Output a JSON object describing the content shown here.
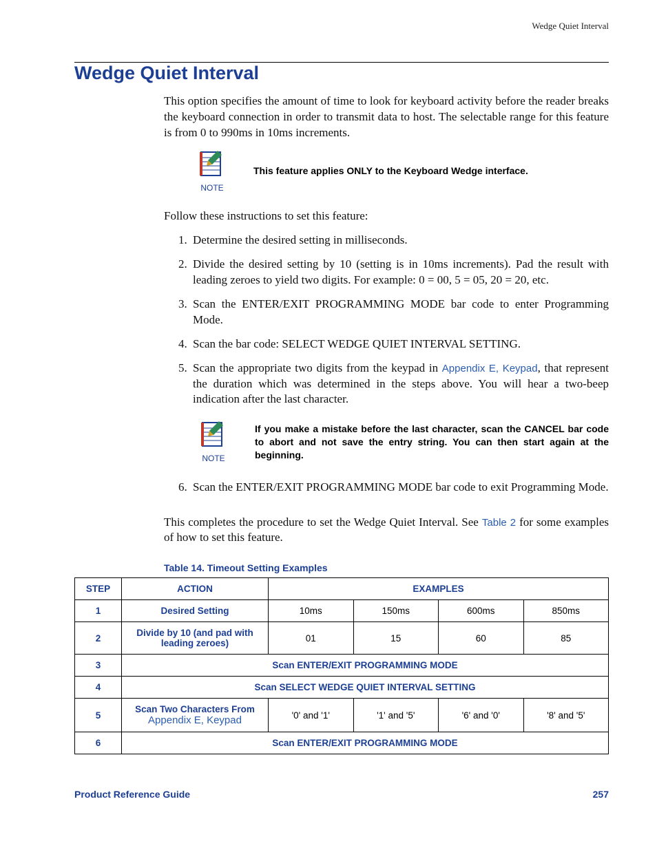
{
  "running_head": "Wedge Quiet Interval",
  "title": "Wedge Quiet Interval",
  "intro": "This option specifies the amount of time to look for keyboard activity before the reader breaks the keyboard connection in order to transmit data to host. The selectable range for this feature is from 0 to 990ms in 10ms increments.",
  "note1_label": "NOTE",
  "note1_text": "This feature applies ONLY to the Keyboard Wedge interface.",
  "follow": "Follow these instructions to set this feature:",
  "steps": {
    "s1": "Determine the desired setting in milliseconds.",
    "s2": "Divide the desired setting by 10 (setting is in 10ms increments).  Pad the result with leading zeroes to yield two digits. For example: 0 = 00, 5 = 05, 20 = 20, etc.",
    "s3": "Scan the ENTER/EXIT PROGRAMMING MODE bar code to enter Programming Mode.",
    "s4": "Scan the bar code: SELECT WEDGE QUIET INTERVAL SETTING.",
    "s5_pre": "Scan the appropriate two digits from the keypad in ",
    "s5_link": "Appendix E, Keypad",
    "s5_post": ", that represent the duration which was determined in the steps above. You will hear a two-beep indication after the last character.",
    "s6": "Scan the ENTER/EXIT PROGRAMMING MODE bar code to exit Programming Mode."
  },
  "note2_label": "NOTE",
  "note2_text": "If you make a mistake before the last character, scan the CANCEL bar code to abort and not save the entry string. You can then start again at the beginning.",
  "closing_pre": "This completes the procedure to set the Wedge Quiet Interval. See ",
  "closing_link": "Table 2",
  "closing_post": " for some examples of how to set this feature.",
  "table_caption": "Table 14. Timeout Setting Examples",
  "table": {
    "head": {
      "step": "STEP",
      "action": "ACTION",
      "examples": "EXAMPLES"
    },
    "r1": {
      "step": "1",
      "action": "Desired Setting",
      "c1": "10ms",
      "c2": "150ms",
      "c3": "600ms",
      "c4": "850ms"
    },
    "r2": {
      "step": "2",
      "action": "Divide by 10 (and pad with leading zeroes)",
      "c1": "01",
      "c2": "15",
      "c3": "60",
      "c4": "85"
    },
    "r3": {
      "step": "3",
      "action": "Scan ENTER/EXIT PROGRAMMING MODE"
    },
    "r4": {
      "step": "4",
      "action": "Scan SELECT WEDGE QUIET INTERVAL SETTING"
    },
    "r5": {
      "step": "5",
      "action_pre": "Scan Two Characters From ",
      "action_link": "Appendix E, Keypad",
      "c1": "'0' and '1'",
      "c2": "'1' and '5'",
      "c3": "'6' and '0'",
      "c4": "'8' and '5'"
    },
    "r6": {
      "step": "6",
      "action": "Scan ENTER/EXIT PROGRAMMING MODE"
    }
  },
  "footer_left": "Product Reference Guide",
  "footer_right": "257"
}
